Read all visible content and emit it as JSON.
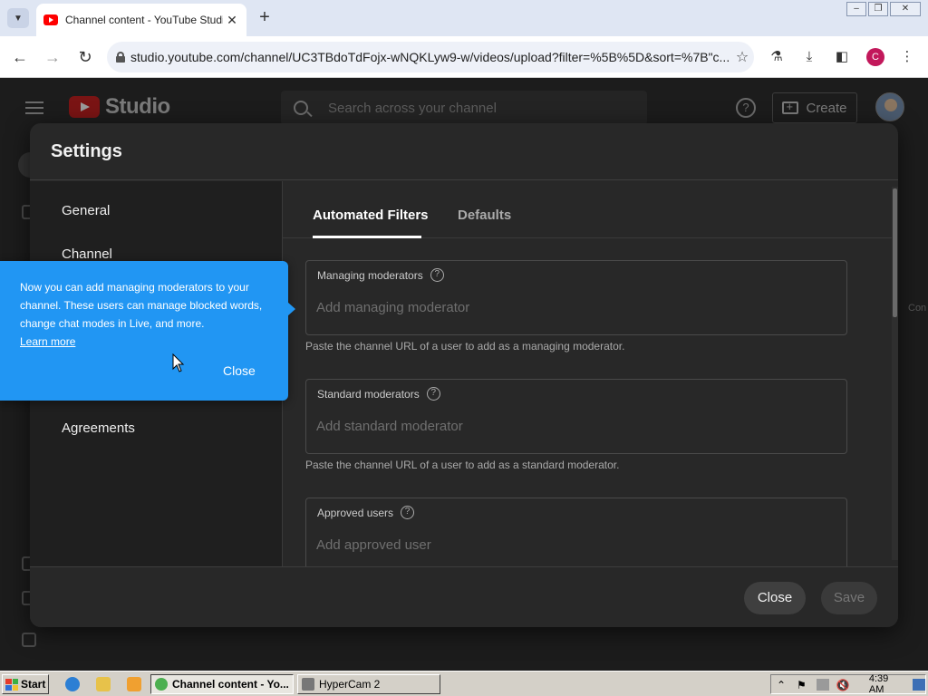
{
  "browser": {
    "tab_title": "Channel content - YouTube Studio",
    "tab_close_glyph": "✕",
    "new_tab_glyph": "+",
    "url": "studio.youtube.com/channel/UC3TBdoTdFojx-wNQKLyw9-w/videos/upload?filter=%5B%5D&sort=%7B\"c...",
    "profile_initial": "C",
    "window_controls": [
      "–",
      "❐",
      "✕"
    ]
  },
  "studio": {
    "logo_text": "Studio",
    "search_placeholder": "Search across your channel",
    "create_label": "Create",
    "help_glyph": "?",
    "side_text": "Con"
  },
  "dialog": {
    "title": "Settings",
    "nav": [
      {
        "label": "General"
      },
      {
        "label": "Channel"
      },
      {
        "label": "Agreements"
      }
    ],
    "tabs": [
      {
        "label": "Automated Filters",
        "active": true
      },
      {
        "label": "Defaults",
        "active": false
      }
    ],
    "fields": [
      {
        "label": "Managing moderators",
        "placeholder": "Add managing moderator",
        "help": "Paste the channel URL of a user to add as a managing moderator."
      },
      {
        "label": "Standard moderators",
        "placeholder": "Add standard moderator",
        "help": "Paste the channel URL of a user to add as a standard moderator."
      },
      {
        "label": "Approved users",
        "placeholder": "Add approved user",
        "help": ""
      }
    ],
    "question_glyph": "?",
    "close_label": "Close",
    "save_label": "Save"
  },
  "tooltip": {
    "text": "Now you can add managing moderators to your channel. These users can manage blocked words, change chat modes in Live, and more.",
    "link": "Learn more",
    "close": "Close"
  },
  "taskbar": {
    "start_label": "Start",
    "tasks": [
      {
        "label": "Channel content - Yo...",
        "active": true
      },
      {
        "label": "HyperCam 2",
        "active": false
      }
    ],
    "clock": "4:39 AM"
  },
  "colors": {
    "tooltip_bg": "#2196f3",
    "dialog_bg": "#282828",
    "youtube_red": "#ff0000",
    "profile_badge": "#c2185b"
  }
}
